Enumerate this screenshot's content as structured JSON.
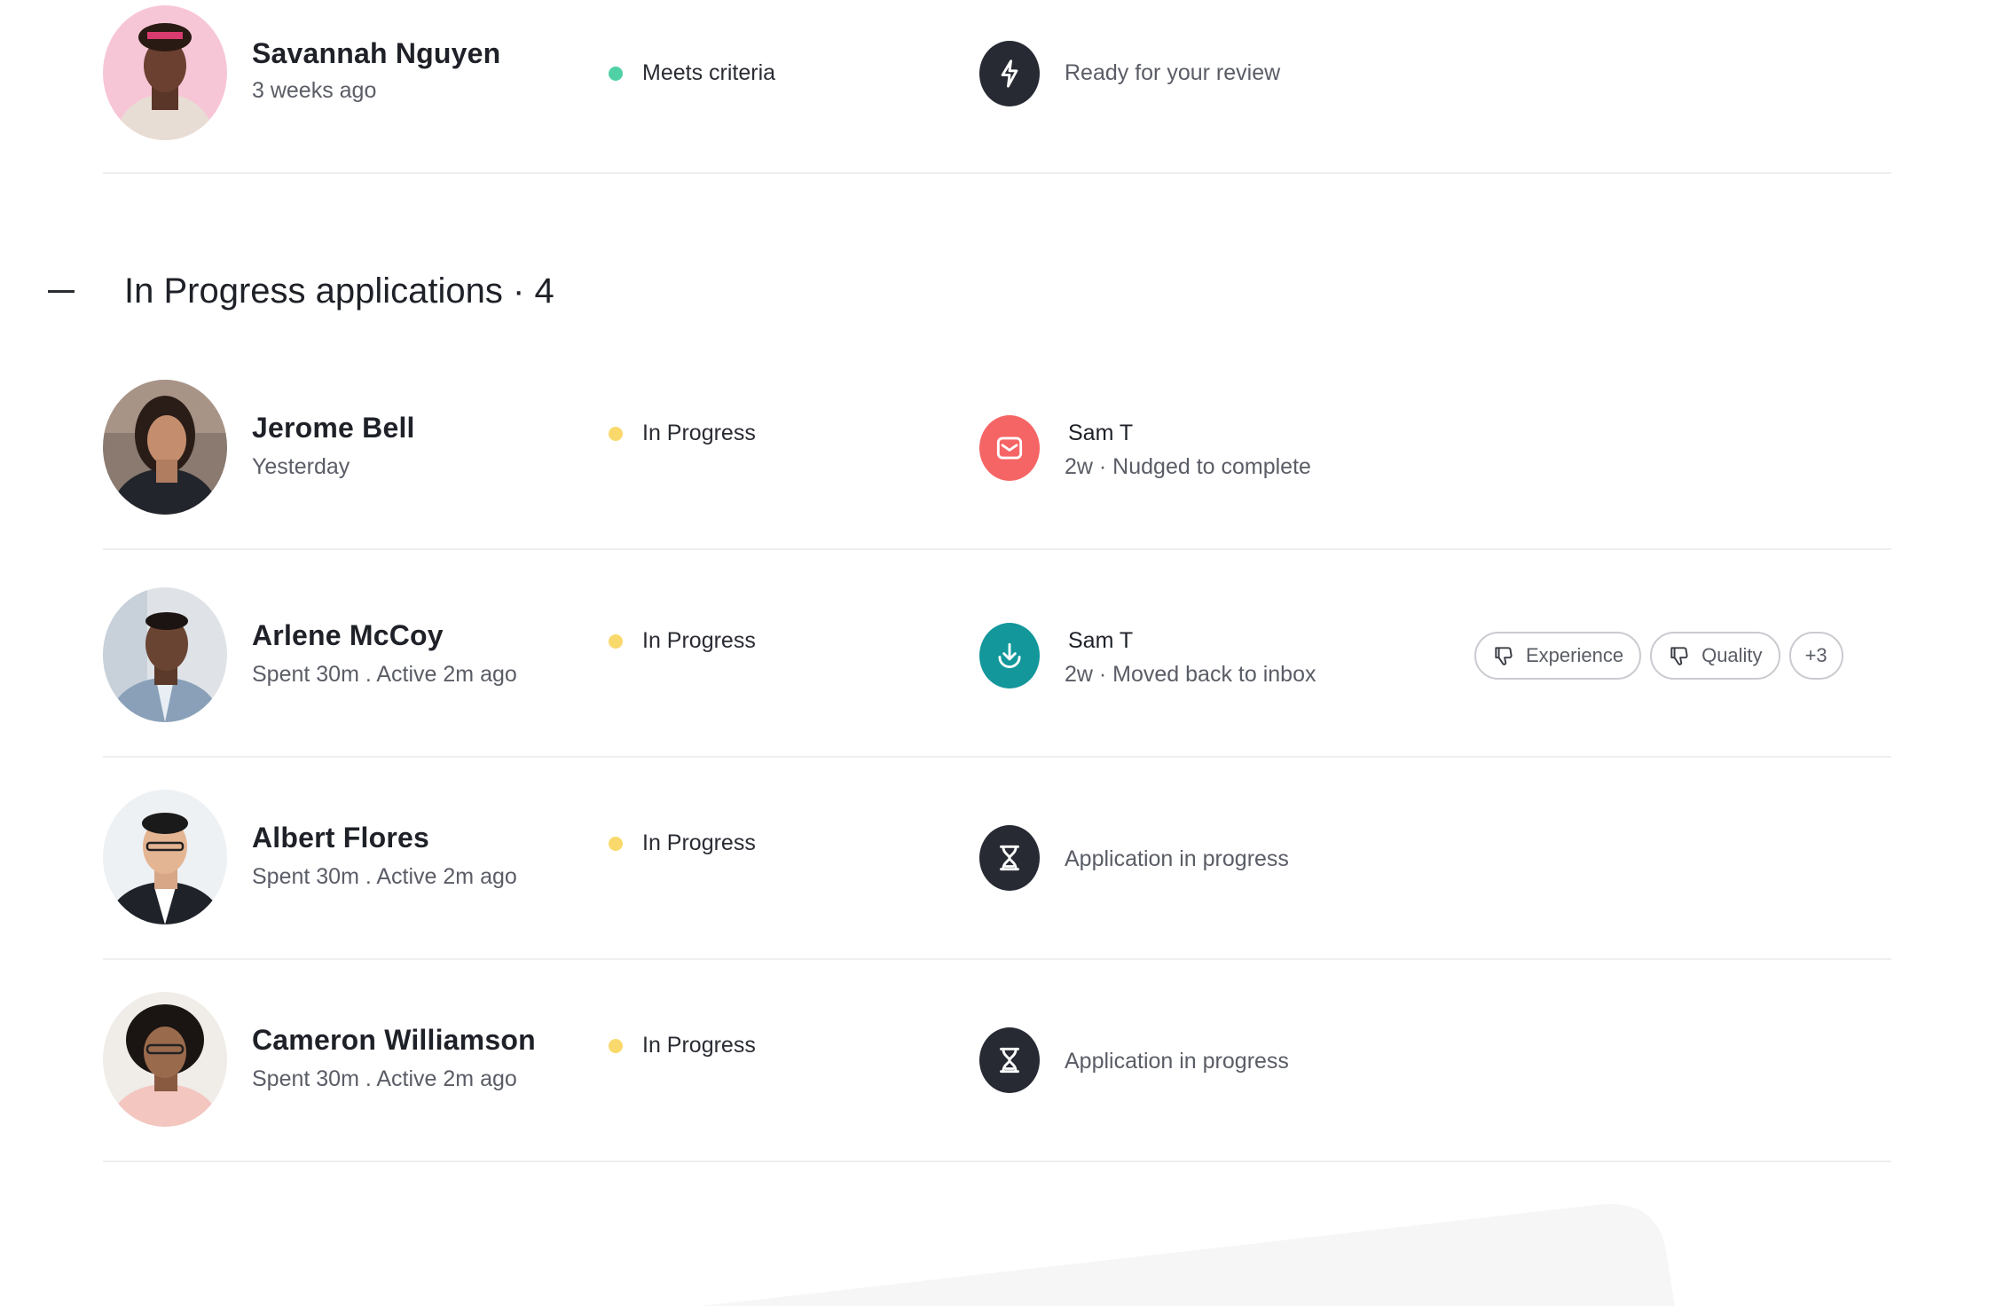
{
  "top_row": {
    "name": "Savannah Nguyen",
    "meta": "3 weeks ago",
    "status": "Meets criteria",
    "status_color": "#4fd1a5",
    "activity": "Ready for your review",
    "activity_icon": "bolt-icon"
  },
  "section": {
    "title": "In Progress applications · 4",
    "collapse_icon": "minus-icon"
  },
  "applicants": [
    {
      "name": "Jerome Bell",
      "meta": "Yesterday",
      "status": "In Progress",
      "actor": "Sam T",
      "sub": "2w ·  Nudged to complete",
      "activity_icon": "mail-icon",
      "icon_color": "#f56565"
    },
    {
      "name": "Arlene McCoy",
      "meta": "Spent 30m . Active 2m ago",
      "status": "In Progress",
      "actor": "Sam T",
      "sub": "2w ·  Moved back to inbox",
      "activity_icon": "download-icon",
      "icon_color": "#13979b",
      "tags": [
        "Experience",
        "Quality",
        "+3"
      ]
    },
    {
      "name": "Albert Flores",
      "meta": "Spent 30m . Active 2m ago",
      "status": "In Progress",
      "activity": "Application in progress",
      "activity_icon": "hourglass-icon",
      "icon_color": "#272a33"
    },
    {
      "name": "Cameron Williamson",
      "meta": "Spent 30m . Active 2m ago",
      "status": "In Progress",
      "activity": "Application in progress",
      "activity_icon": "hourglass-icon",
      "icon_color": "#272a33"
    }
  ],
  "colors": {
    "in_progress_dot": "#f9d96b",
    "dark_icon": "#272a33",
    "divider": "#eeeff1"
  }
}
